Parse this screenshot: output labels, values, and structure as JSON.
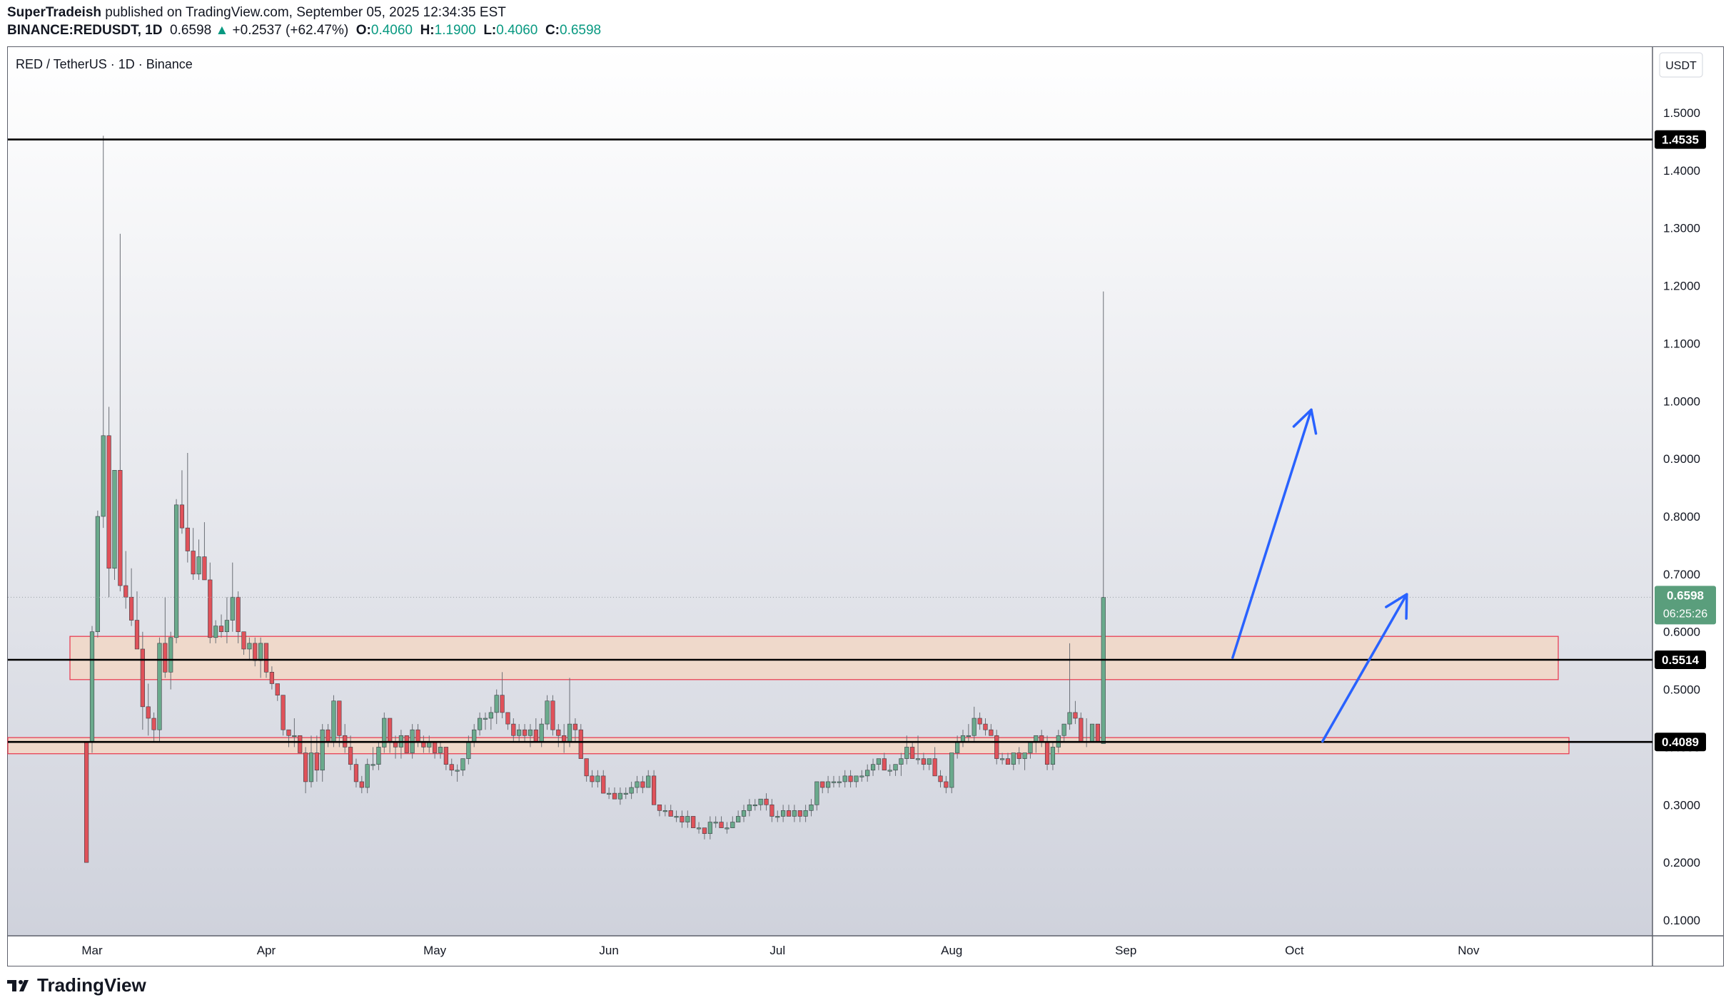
{
  "header": {
    "author": "SuperTradeish",
    "published_text": "published on TradingView.com, September 05, 2025 12:34:35 EST",
    "symbol": "BINANCE:REDUSDT, 1D",
    "last": "0.6598",
    "change": "+0.2537 (+62.47%)",
    "o_label": "O:",
    "o_value": "0.4060",
    "h_label": "H:",
    "h_value": "1.1900",
    "l_label": "L:",
    "l_value": "0.4060",
    "c_label": "C:",
    "c_value": "0.6598"
  },
  "chart_title": "RED / TetherUS · 1D · Binance",
  "currency_label": "USDT",
  "footer": {
    "brand": "TradingView",
    "logo_icon": "tradingview-logo-icon"
  },
  "colors": {
    "up": "#6aaa8c",
    "down": "#e0525a",
    "accent_line": "#000000",
    "arrow": "#2962ff",
    "zone_fill": "#f2d7c5",
    "zone_border": "#e8334a"
  },
  "chart_data": {
    "type": "candlestick",
    "title": "RED / TetherUS · 1D · Binance",
    "y_axis": {
      "unit": "USDT",
      "range": [
        0.05,
        1.58
      ],
      "ticks": [
        "1.5000",
        "1.4000",
        "1.3000",
        "1.2000",
        "1.1000",
        "1.0000",
        "0.9000",
        "0.8000",
        "0.7000",
        "0.6000",
        "0.5000",
        "0.4000",
        "0.3000",
        "0.2000",
        "0.1000"
      ]
    },
    "x_axis": {
      "labels": [
        "Mar",
        "Apr",
        "May",
        "Jun",
        "Jul",
        "Aug",
        "Sep",
        "Oct",
        "Nov"
      ],
      "label_dates": [
        "2025-03-01",
        "2025-04-01",
        "2025-05-01",
        "2025-06-01",
        "2025-07-01",
        "2025-08-01",
        "2025-09-01",
        "2025-10-01",
        "2025-11-01"
      ],
      "range": [
        "2025-02-19",
        "2025-11-25"
      ]
    },
    "first_candle_date": "2025-02-28",
    "candles": [
      [
        0.41,
        0.41,
        0.2,
        0.2
      ],
      [
        0.41,
        0.61,
        0.39,
        0.6
      ],
      [
        0.6,
        0.81,
        0.59,
        0.8
      ],
      [
        0.8,
        1.46,
        0.78,
        0.94
      ],
      [
        0.94,
        0.99,
        0.66,
        0.71
      ],
      [
        0.71,
        0.88,
        0.69,
        0.88
      ],
      [
        0.88,
        1.29,
        0.67,
        0.68
      ],
      [
        0.68,
        0.74,
        0.64,
        0.66
      ],
      [
        0.66,
        0.71,
        0.61,
        0.62
      ],
      [
        0.62,
        0.67,
        0.57,
        0.57
      ],
      [
        0.57,
        0.6,
        0.43,
        0.47
      ],
      [
        0.47,
        0.51,
        0.42,
        0.45
      ],
      [
        0.45,
        0.46,
        0.41,
        0.43
      ],
      [
        0.43,
        0.59,
        0.41,
        0.58
      ],
      [
        0.58,
        0.66,
        0.52,
        0.53
      ],
      [
        0.53,
        0.6,
        0.5,
        0.59
      ],
      [
        0.59,
        0.83,
        0.58,
        0.82
      ],
      [
        0.82,
        0.88,
        0.77,
        0.78
      ],
      [
        0.78,
        0.91,
        0.72,
        0.74
      ],
      [
        0.74,
        0.78,
        0.69,
        0.7
      ],
      [
        0.7,
        0.76,
        0.69,
        0.73
      ],
      [
        0.73,
        0.79,
        0.69,
        0.69
      ],
      [
        0.69,
        0.72,
        0.58,
        0.59
      ],
      [
        0.59,
        0.62,
        0.58,
        0.61
      ],
      [
        0.61,
        0.63,
        0.59,
        0.6
      ],
      [
        0.6,
        0.66,
        0.58,
        0.62
      ],
      [
        0.62,
        0.72,
        0.6,
        0.66
      ],
      [
        0.66,
        0.67,
        0.58,
        0.6
      ],
      [
        0.6,
        0.6,
        0.56,
        0.57
      ],
      [
        0.57,
        0.59,
        0.55,
        0.58
      ],
      [
        0.58,
        0.59,
        0.54,
        0.55
      ],
      [
        0.55,
        0.59,
        0.52,
        0.58
      ],
      [
        0.58,
        0.58,
        0.52,
        0.53
      ],
      [
        0.53,
        0.54,
        0.5,
        0.51
      ],
      [
        0.51,
        0.51,
        0.48,
        0.49
      ],
      [
        0.49,
        0.49,
        0.42,
        0.43
      ],
      [
        0.43,
        0.43,
        0.4,
        0.42
      ],
      [
        0.42,
        0.45,
        0.4,
        0.42
      ],
      [
        0.42,
        0.42,
        0.39,
        0.39
      ],
      [
        0.39,
        0.4,
        0.32,
        0.34
      ],
      [
        0.34,
        0.42,
        0.33,
        0.39
      ],
      [
        0.39,
        0.42,
        0.34,
        0.36
      ],
      [
        0.36,
        0.44,
        0.34,
        0.43
      ],
      [
        0.43,
        0.44,
        0.4,
        0.41
      ],
      [
        0.41,
        0.49,
        0.4,
        0.48
      ],
      [
        0.48,
        0.48,
        0.4,
        0.42
      ],
      [
        0.42,
        0.44,
        0.39,
        0.4
      ],
      [
        0.4,
        0.42,
        0.36,
        0.37
      ],
      [
        0.37,
        0.38,
        0.33,
        0.34
      ],
      [
        0.34,
        0.35,
        0.32,
        0.33
      ],
      [
        0.33,
        0.38,
        0.32,
        0.37
      ],
      [
        0.37,
        0.4,
        0.36,
        0.37
      ],
      [
        0.37,
        0.41,
        0.36,
        0.4
      ],
      [
        0.4,
        0.46,
        0.39,
        0.45
      ],
      [
        0.45,
        0.45,
        0.39,
        0.41
      ],
      [
        0.41,
        0.42,
        0.38,
        0.4
      ],
      [
        0.4,
        0.43,
        0.38,
        0.42
      ],
      [
        0.42,
        0.42,
        0.39,
        0.39
      ],
      [
        0.39,
        0.44,
        0.38,
        0.43
      ],
      [
        0.43,
        0.44,
        0.4,
        0.41
      ],
      [
        0.41,
        0.42,
        0.39,
        0.4
      ],
      [
        0.4,
        0.42,
        0.39,
        0.41
      ],
      [
        0.41,
        0.41,
        0.38,
        0.39
      ],
      [
        0.39,
        0.41,
        0.38,
        0.4
      ],
      [
        0.4,
        0.4,
        0.36,
        0.37
      ],
      [
        0.37,
        0.38,
        0.35,
        0.36
      ],
      [
        0.36,
        0.37,
        0.34,
        0.36
      ],
      [
        0.36,
        0.38,
        0.35,
        0.38
      ],
      [
        0.38,
        0.42,
        0.37,
        0.41
      ],
      [
        0.41,
        0.44,
        0.4,
        0.43
      ],
      [
        0.43,
        0.46,
        0.42,
        0.45
      ],
      [
        0.45,
        0.46,
        0.43,
        0.45
      ],
      [
        0.45,
        0.47,
        0.43,
        0.46
      ],
      [
        0.46,
        0.5,
        0.44,
        0.49
      ],
      [
        0.49,
        0.53,
        0.45,
        0.46
      ],
      [
        0.46,
        0.46,
        0.43,
        0.44
      ],
      [
        0.44,
        0.45,
        0.41,
        0.42
      ],
      [
        0.42,
        0.44,
        0.41,
        0.43
      ],
      [
        0.43,
        0.44,
        0.41,
        0.42
      ],
      [
        0.42,
        0.44,
        0.4,
        0.43
      ],
      [
        0.43,
        0.45,
        0.41,
        0.41
      ],
      [
        0.41,
        0.45,
        0.4,
        0.44
      ],
      [
        0.44,
        0.49,
        0.43,
        0.48
      ],
      [
        0.48,
        0.49,
        0.42,
        0.43
      ],
      [
        0.43,
        0.44,
        0.4,
        0.42
      ],
      [
        0.42,
        0.44,
        0.39,
        0.41
      ],
      [
        0.41,
        0.52,
        0.4,
        0.44
      ],
      [
        0.44,
        0.45,
        0.41,
        0.43
      ],
      [
        0.43,
        0.44,
        0.38,
        0.38
      ],
      [
        0.38,
        0.38,
        0.34,
        0.35
      ],
      [
        0.35,
        0.36,
        0.33,
        0.34
      ],
      [
        0.34,
        0.36,
        0.33,
        0.35
      ],
      [
        0.35,
        0.36,
        0.32,
        0.32
      ],
      [
        0.32,
        0.33,
        0.31,
        0.32
      ],
      [
        0.32,
        0.33,
        0.31,
        0.31
      ],
      [
        0.31,
        0.33,
        0.3,
        0.32
      ],
      [
        0.32,
        0.33,
        0.31,
        0.32
      ],
      [
        0.32,
        0.34,
        0.31,
        0.33
      ],
      [
        0.33,
        0.35,
        0.32,
        0.34
      ],
      [
        0.34,
        0.35,
        0.32,
        0.33
      ],
      [
        0.33,
        0.36,
        0.33,
        0.35
      ],
      [
        0.35,
        0.36,
        0.3,
        0.3
      ],
      [
        0.3,
        0.3,
        0.28,
        0.29
      ],
      [
        0.29,
        0.3,
        0.28,
        0.29
      ],
      [
        0.29,
        0.3,
        0.28,
        0.28
      ],
      [
        0.28,
        0.29,
        0.27,
        0.28
      ],
      [
        0.28,
        0.29,
        0.26,
        0.27
      ],
      [
        0.27,
        0.29,
        0.26,
        0.28
      ],
      [
        0.28,
        0.28,
        0.26,
        0.26
      ],
      [
        0.26,
        0.27,
        0.25,
        0.26
      ],
      [
        0.26,
        0.26,
        0.24,
        0.25
      ],
      [
        0.25,
        0.28,
        0.24,
        0.27
      ],
      [
        0.27,
        0.28,
        0.26,
        0.27
      ],
      [
        0.27,
        0.28,
        0.26,
        0.26
      ],
      [
        0.26,
        0.27,
        0.25,
        0.26
      ],
      [
        0.26,
        0.28,
        0.26,
        0.27
      ],
      [
        0.27,
        0.29,
        0.27,
        0.28
      ],
      [
        0.28,
        0.3,
        0.27,
        0.29
      ],
      [
        0.29,
        0.31,
        0.28,
        0.3
      ],
      [
        0.3,
        0.31,
        0.29,
        0.3
      ],
      [
        0.3,
        0.31,
        0.29,
        0.31
      ],
      [
        0.31,
        0.32,
        0.29,
        0.3
      ],
      [
        0.3,
        0.31,
        0.27,
        0.28
      ],
      [
        0.28,
        0.29,
        0.27,
        0.28
      ],
      [
        0.28,
        0.3,
        0.27,
        0.29
      ],
      [
        0.29,
        0.3,
        0.28,
        0.28
      ],
      [
        0.28,
        0.3,
        0.27,
        0.29
      ],
      [
        0.29,
        0.29,
        0.27,
        0.28
      ],
      [
        0.28,
        0.3,
        0.27,
        0.29
      ],
      [
        0.29,
        0.31,
        0.28,
        0.3
      ],
      [
        0.3,
        0.34,
        0.29,
        0.34
      ],
      [
        0.34,
        0.34,
        0.32,
        0.33
      ],
      [
        0.33,
        0.35,
        0.32,
        0.34
      ],
      [
        0.34,
        0.35,
        0.33,
        0.34
      ],
      [
        0.34,
        0.35,
        0.33,
        0.34
      ],
      [
        0.34,
        0.36,
        0.33,
        0.35
      ],
      [
        0.35,
        0.36,
        0.33,
        0.34
      ],
      [
        0.34,
        0.35,
        0.33,
        0.35
      ],
      [
        0.35,
        0.36,
        0.34,
        0.35
      ],
      [
        0.35,
        0.37,
        0.34,
        0.36
      ],
      [
        0.36,
        0.38,
        0.35,
        0.37
      ],
      [
        0.37,
        0.38,
        0.36,
        0.38
      ],
      [
        0.38,
        0.39,
        0.36,
        0.36
      ],
      [
        0.36,
        0.37,
        0.35,
        0.36
      ],
      [
        0.36,
        0.37,
        0.35,
        0.37
      ],
      [
        0.37,
        0.39,
        0.35,
        0.38
      ],
      [
        0.38,
        0.42,
        0.37,
        0.4
      ],
      [
        0.4,
        0.41,
        0.38,
        0.38
      ],
      [
        0.38,
        0.42,
        0.37,
        0.38
      ],
      [
        0.38,
        0.39,
        0.36,
        0.37
      ],
      [
        0.37,
        0.38,
        0.36,
        0.38
      ],
      [
        0.38,
        0.4,
        0.36,
        0.35
      ],
      [
        0.35,
        0.36,
        0.33,
        0.34
      ],
      [
        0.34,
        0.35,
        0.32,
        0.33
      ],
      [
        0.33,
        0.39,
        0.32,
        0.39
      ],
      [
        0.39,
        0.42,
        0.38,
        0.41
      ],
      [
        0.41,
        0.43,
        0.4,
        0.42
      ],
      [
        0.42,
        0.44,
        0.41,
        0.42
      ],
      [
        0.42,
        0.47,
        0.41,
        0.45
      ],
      [
        0.45,
        0.46,
        0.43,
        0.44
      ],
      [
        0.44,
        0.45,
        0.42,
        0.43
      ],
      [
        0.43,
        0.44,
        0.42,
        0.42
      ],
      [
        0.42,
        0.43,
        0.37,
        0.38
      ],
      [
        0.38,
        0.39,
        0.37,
        0.38
      ],
      [
        0.38,
        0.39,
        0.37,
        0.37
      ],
      [
        0.37,
        0.39,
        0.36,
        0.39
      ],
      [
        0.39,
        0.4,
        0.37,
        0.38
      ],
      [
        0.38,
        0.39,
        0.36,
        0.39
      ],
      [
        0.39,
        0.41,
        0.38,
        0.41
      ],
      [
        0.41,
        0.42,
        0.39,
        0.42
      ],
      [
        0.42,
        0.43,
        0.4,
        0.41
      ],
      [
        0.41,
        0.42,
        0.36,
        0.37
      ],
      [
        0.37,
        0.41,
        0.36,
        0.4
      ],
      [
        0.4,
        0.43,
        0.39,
        0.42
      ],
      [
        0.42,
        0.44,
        0.41,
        0.44
      ],
      [
        0.44,
        0.58,
        0.43,
        0.46
      ],
      [
        0.46,
        0.48,
        0.44,
        0.45
      ],
      [
        0.45,
        0.46,
        0.41,
        0.41
      ],
      [
        0.41,
        0.45,
        0.4,
        0.41
      ],
      [
        0.41,
        0.44,
        0.41,
        0.44
      ],
      [
        0.44,
        0.44,
        0.41,
        0.41
      ],
      [
        0.406,
        1.19,
        0.406,
        0.6598
      ]
    ],
    "horizontal_levels": [
      {
        "price": 1.4535,
        "label": "1.4535"
      },
      {
        "price": 0.5514,
        "label": "0.5514"
      },
      {
        "price": 0.4089,
        "label": "0.4089"
      }
    ],
    "zones": [
      {
        "from": 0.517,
        "to": 0.592
      },
      {
        "from": 0.3885,
        "to": 0.4165
      }
    ],
    "current_price": {
      "value": 0.6598,
      "label": "0.6598",
      "countdown": "06:25:26"
    },
    "arrows": [
      {
        "start_date": "2025-09-20",
        "start_price": 0.555,
        "end_date": "2025-10-04",
        "end_price": 0.985
      },
      {
        "start_date": "2025-10-06",
        "start_price": 0.41,
        "end_date": "2025-10-21",
        "end_price": 0.665
      }
    ]
  }
}
